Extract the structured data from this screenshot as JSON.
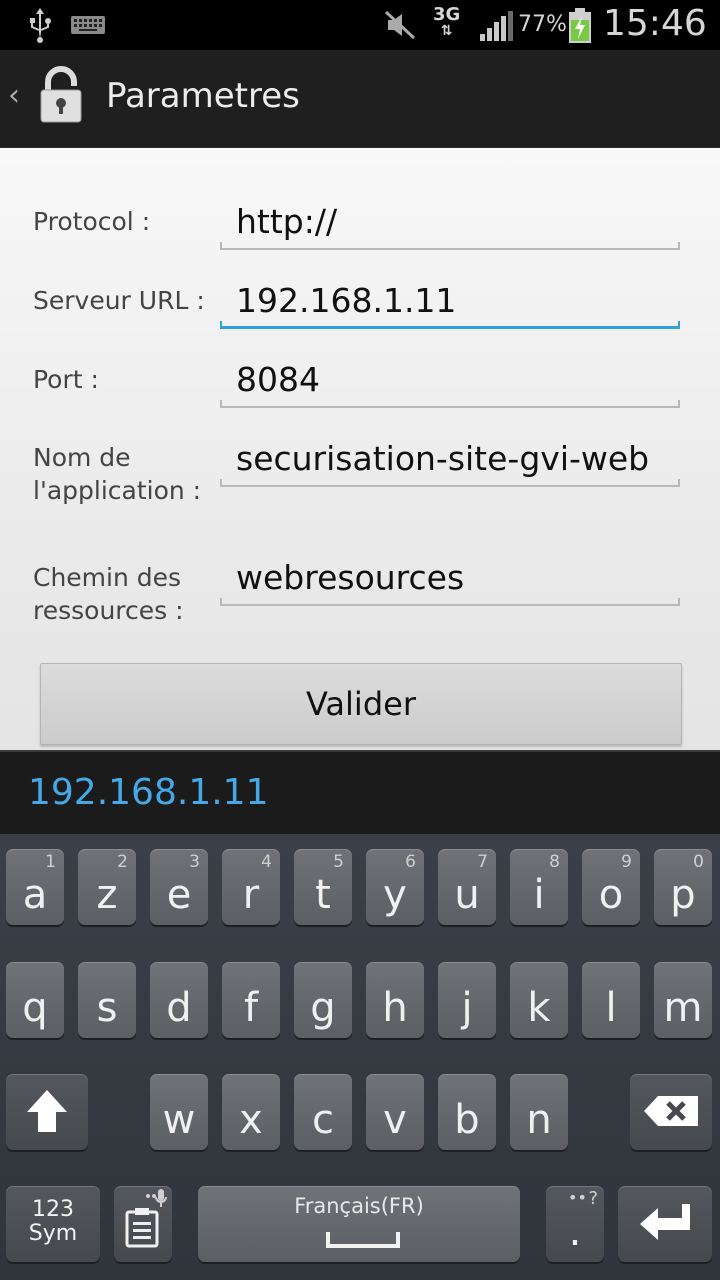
{
  "status_bar": {
    "network": "3G",
    "battery_percent": "77%",
    "time": "15:46",
    "icons": [
      "usb-icon",
      "keyboard-icon",
      "mute-icon",
      "network-arrows-icon",
      "signal-icon",
      "battery-charging-icon"
    ]
  },
  "action_bar": {
    "title": "Parametres",
    "icons": [
      "back-chevron-icon",
      "lock-icon"
    ]
  },
  "form": {
    "protocol": {
      "label": "Protocol :",
      "value": "http://"
    },
    "server_url": {
      "label": "Serveur URL :",
      "value": "192.168.1.11"
    },
    "port": {
      "label": "Port :",
      "value": "8084"
    },
    "app_name": {
      "label_line1": "Nom de",
      "label_line2": "l'application :",
      "value": "securisation-site-gvi-web"
    },
    "resources_path": {
      "label_line1": "Chemin des",
      "label_line2": "ressources :",
      "value": "webresources"
    },
    "submit_label": "Valider"
  },
  "keyboard": {
    "suggestion": "192.168.1.11",
    "row1": [
      {
        "ch": "a",
        "num": "1"
      },
      {
        "ch": "z",
        "num": "2"
      },
      {
        "ch": "e",
        "num": "3"
      },
      {
        "ch": "r",
        "num": "4"
      },
      {
        "ch": "t",
        "num": "5"
      },
      {
        "ch": "y",
        "num": "6"
      },
      {
        "ch": "u",
        "num": "7"
      },
      {
        "ch": "i",
        "num": "8"
      },
      {
        "ch": "o",
        "num": "9"
      },
      {
        "ch": "p",
        "num": "0"
      }
    ],
    "row2": [
      "q",
      "s",
      "d",
      "f",
      "g",
      "h",
      "j",
      "k",
      "l",
      "m"
    ],
    "row3": [
      "w",
      "x",
      "c",
      "v",
      "b",
      "n"
    ],
    "sym_line1": "123",
    "sym_line2": "Sym",
    "language": "Français(FR)",
    "period": ".",
    "period_hint": "?"
  },
  "colors": {
    "accent": "#33a0d8",
    "suggestion": "#44a9e6"
  }
}
